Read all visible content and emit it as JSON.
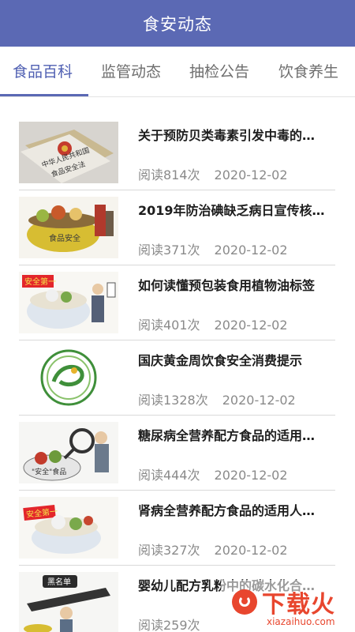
{
  "app_bar": {
    "title": "食安动态"
  },
  "tabs": [
    {
      "label": "食品百科",
      "active": true
    },
    {
      "label": "监管动态",
      "active": false
    },
    {
      "label": "抽检公告",
      "active": false
    },
    {
      "label": "饮食养生",
      "active": false
    }
  ],
  "articles": [
    {
      "title": "关于预防贝类毒素引发中毒的…",
      "reads": "阅读814次",
      "date": "2020-12-02",
      "thumb_icon": "food-safety-law-book-image"
    },
    {
      "title": "2019年防治碘缺乏病日宣传核…",
      "reads": "阅读371次",
      "date": "2020-12-02",
      "thumb_icon": "food-safety-bowl-cartoon-image"
    },
    {
      "title": "如何读懂预包装食用植物油标签",
      "reads": "阅读401次",
      "date": "2020-12-02",
      "thumb_icon": "safety-first-bowl-inspector-cartoon-image"
    },
    {
      "title": "国庆黄金周饮食安全消费提示",
      "reads": "阅读1328次",
      "date": "2020-12-02",
      "thumb_icon": "china-food-security-logo-image"
    },
    {
      "title": "糖尿病全营养配方食品的适用…",
      "reads": "阅读444次",
      "date": "2020-12-02",
      "thumb_icon": "magnifier-inspector-cartoon-image"
    },
    {
      "title": "肾病全营养配方食品的适用人…",
      "reads": "阅读327次",
      "date": "2020-12-02",
      "thumb_icon": "safety-first-bowl-cartoon-image"
    },
    {
      "title": "婴幼儿配方乳粉中的碳水化合…",
      "reads": "阅读259次",
      "date": "",
      "thumb_icon": "blacklist-cartoon-image"
    }
  ],
  "watermark": {
    "text": "下载火",
    "url": "xiazaihuo.com"
  },
  "colors": {
    "primary": "#5b69b4",
    "watermark": "#e8462e"
  }
}
